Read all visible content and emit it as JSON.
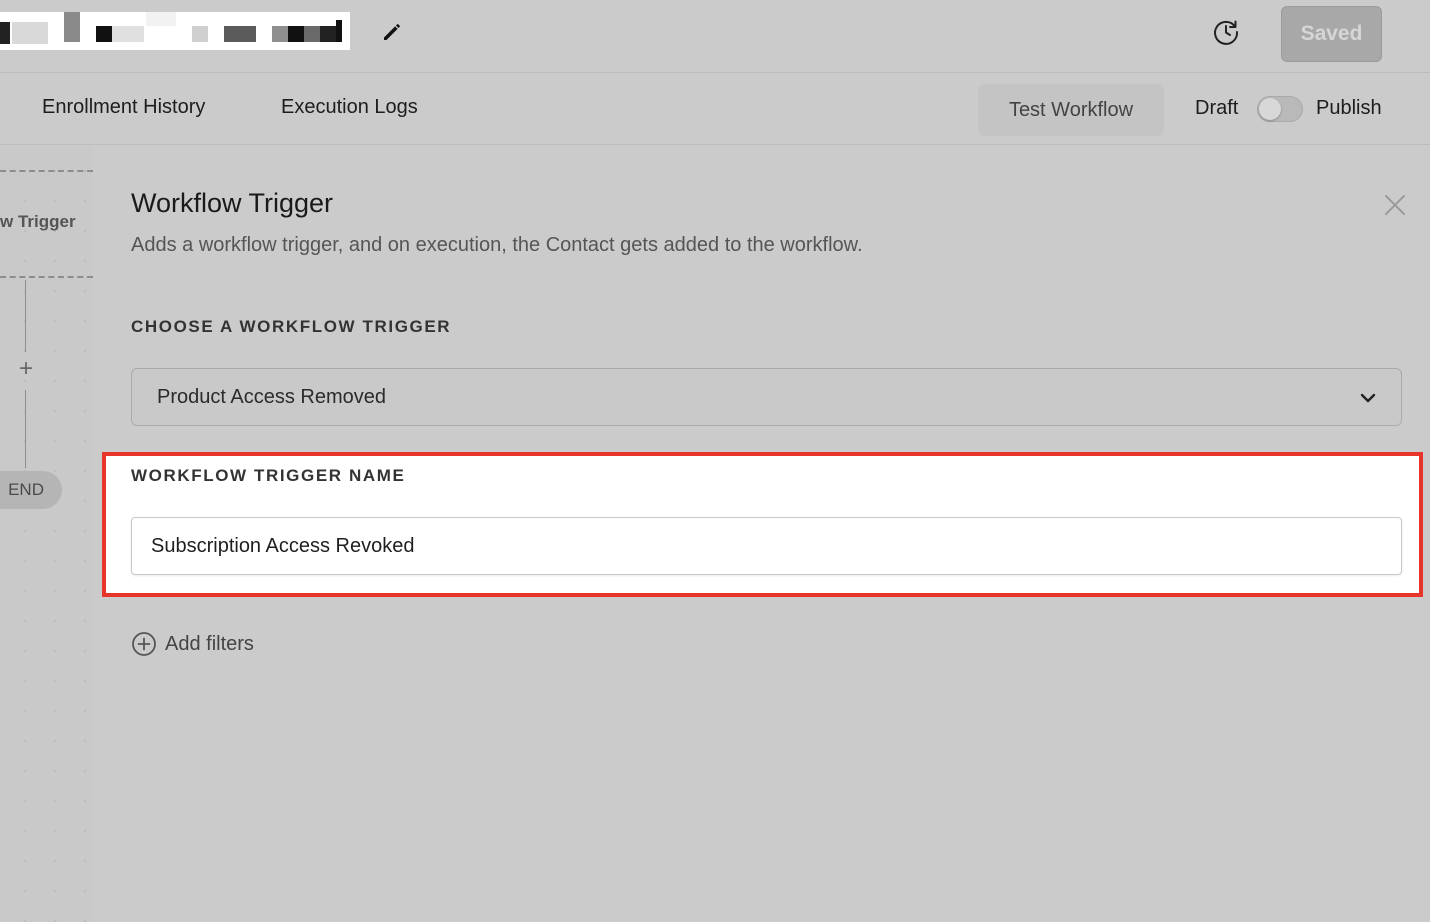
{
  "header": {
    "title_redacted": true,
    "saved_label": "Saved",
    "icons": {
      "edit": "pencil-icon",
      "history": "history-clock-icon"
    }
  },
  "subnav": {
    "tabs": [
      {
        "label": "Enrollment History"
      },
      {
        "label": "Execution Logs"
      }
    ],
    "test_workflow_label": "Test Workflow",
    "draft_label": "Draft",
    "publish_label": "Publish",
    "publish_toggle_on": false
  },
  "canvas": {
    "trigger_node_label": "w Trigger",
    "end_label": "END",
    "add_step_icon": "plus-icon"
  },
  "panel": {
    "title": "Workflow Trigger",
    "description": "Adds a workflow trigger, and on execution, the Contact gets added to the workflow.",
    "choose_label": "CHOOSE A WORKFLOW TRIGGER",
    "selected_trigger": "Product Access Removed",
    "name_label": "WORKFLOW TRIGGER NAME",
    "name_value": "Subscription Access Revoked",
    "add_filters_label": "Add filters",
    "highlight_color": "#e8352b"
  }
}
